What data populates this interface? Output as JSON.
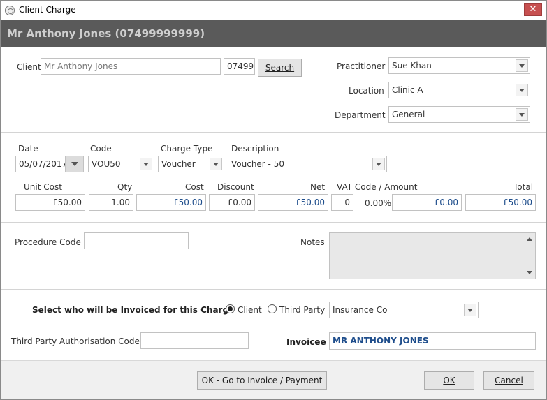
{
  "window": {
    "title": "Client Charge",
    "close_label": "✕"
  },
  "header": {
    "client_name": "Mr Anthony Jones (07499999999)"
  },
  "client": {
    "label": "Client",
    "name_value": "Mr Anthony Jones",
    "phone_value": "07499",
    "search_label": "Search"
  },
  "practitioner": {
    "label": "Practitioner",
    "value": "Sue Khan"
  },
  "location": {
    "label": "Location",
    "value": "Clinic A"
  },
  "department": {
    "label": "Department",
    "value": "General"
  },
  "charge": {
    "date_label": "Date",
    "date_value": "05/07/2017",
    "code_label": "Code",
    "code_value": "VOU50",
    "type_label": "Charge Type",
    "type_value": "Voucher",
    "desc_label": "Description",
    "desc_value": "Voucher - 50",
    "unit_cost_label": "Unit Cost",
    "unit_cost_value": "£50.00",
    "qty_label": "Qty",
    "qty_value": "1.00",
    "cost_label": "Cost",
    "cost_value": "£50.00",
    "discount_label": "Discount",
    "discount_value": "£0.00",
    "net_label": "Net",
    "net_value": "£50.00",
    "vat_label": "VAT Code / Amount",
    "vat_code_value": "0",
    "vat_rate": "0.00%",
    "vat_amount_value": "£0.00",
    "total_label": "Total",
    "total_value": "£50.00"
  },
  "procedure": {
    "label": "Procedure Code",
    "value": ""
  },
  "notes": {
    "label": "Notes",
    "value": ""
  },
  "invoice": {
    "prompt": "Select who will be Invoiced for this Charge",
    "client_option": "Client",
    "third_party_option": "Third Party",
    "third_party_value": "Insurance Co",
    "auth_label": "Third Party Authorisation Code",
    "auth_value": "",
    "invoicee_label": "Invoicee",
    "invoicee_value": "MR ANTHONY JONES"
  },
  "footer": {
    "go_invoice_label": "OK - Go to Invoice / Payment",
    "ok_label": "OK",
    "cancel_label": "Cancel"
  }
}
